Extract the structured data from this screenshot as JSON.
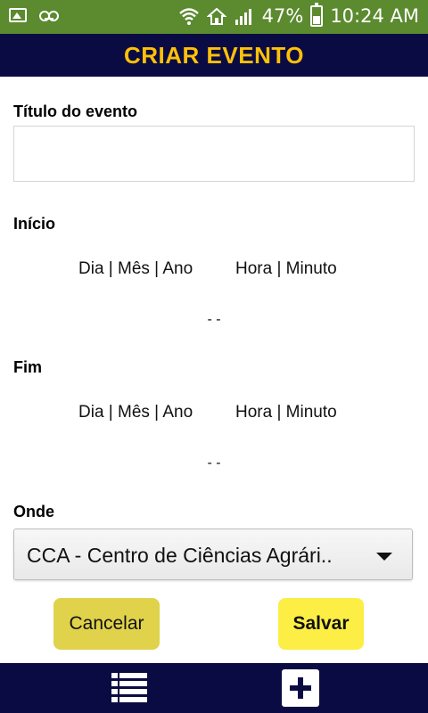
{
  "status_bar": {
    "battery": "47%",
    "time": "10:24 AM"
  },
  "header": {
    "title": "CRIAR EVENTO"
  },
  "form": {
    "title_label": "Título do evento",
    "title_value": "",
    "start_label": "Início",
    "start_date_hint": "Dia | Mês | Ano",
    "start_time_hint": "Hora | Minuto",
    "start_value": "- -",
    "end_label": "Fim",
    "end_date_hint": "Dia | Mês | Ano",
    "end_time_hint": "Hora | Minuto",
    "end_value": "- -",
    "where_label": "Onde",
    "where_selected": "CCA - Centro de Ciências Agrári.."
  },
  "actions": {
    "cancel_label": "Cancelar",
    "save_label": "Salvar"
  },
  "bottom_nav": {
    "items": [
      "list-icon",
      "add-icon"
    ]
  },
  "colors": {
    "status_bar": "#5b8a2f",
    "header_bg": "#0b0b44",
    "title_color": "#ffc107",
    "cancel_bg": "#e0d24a",
    "save_bg": "#fdee45"
  }
}
